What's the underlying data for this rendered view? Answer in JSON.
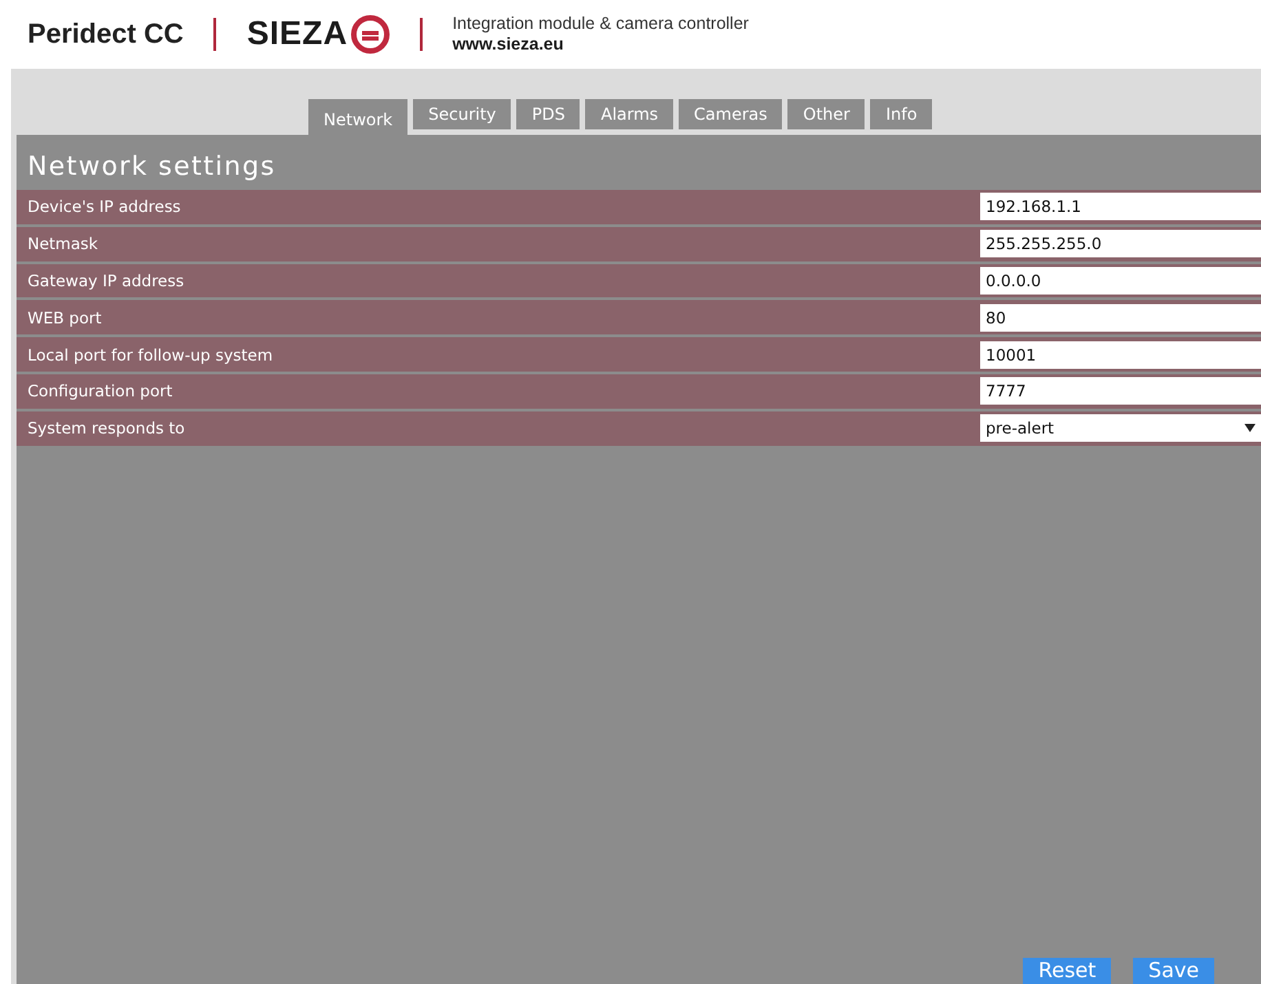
{
  "header": {
    "product": "Peridect CC",
    "brand": "SIEZA",
    "tagline": "Integration module & camera controller",
    "website": "www.sieza.eu"
  },
  "tabs": [
    {
      "label": "Network",
      "selected": true
    },
    {
      "label": "Security",
      "selected": false
    },
    {
      "label": "PDS",
      "selected": false
    },
    {
      "label": "Alarms",
      "selected": false
    },
    {
      "label": "Cameras",
      "selected": false
    },
    {
      "label": "Other",
      "selected": false
    },
    {
      "label": "Info",
      "selected": false
    }
  ],
  "section_title": "Network settings",
  "settings": [
    {
      "label": "Device's IP address",
      "kind": "text",
      "value": "192.168.1.1"
    },
    {
      "label": "Netmask",
      "kind": "text",
      "value": "255.255.255.0"
    },
    {
      "label": "Gateway IP address",
      "kind": "text",
      "value": "0.0.0.0"
    },
    {
      "label": "WEB port",
      "kind": "text",
      "value": "80"
    },
    {
      "label": "Local port for follow-up system",
      "kind": "text",
      "value": "10001"
    },
    {
      "label": "Configuration port",
      "kind": "text",
      "value": "7777"
    },
    {
      "label": "System responds to",
      "kind": "select",
      "value": "pre-alert"
    }
  ],
  "buttons": [
    "Reset",
    "Save"
  ]
}
